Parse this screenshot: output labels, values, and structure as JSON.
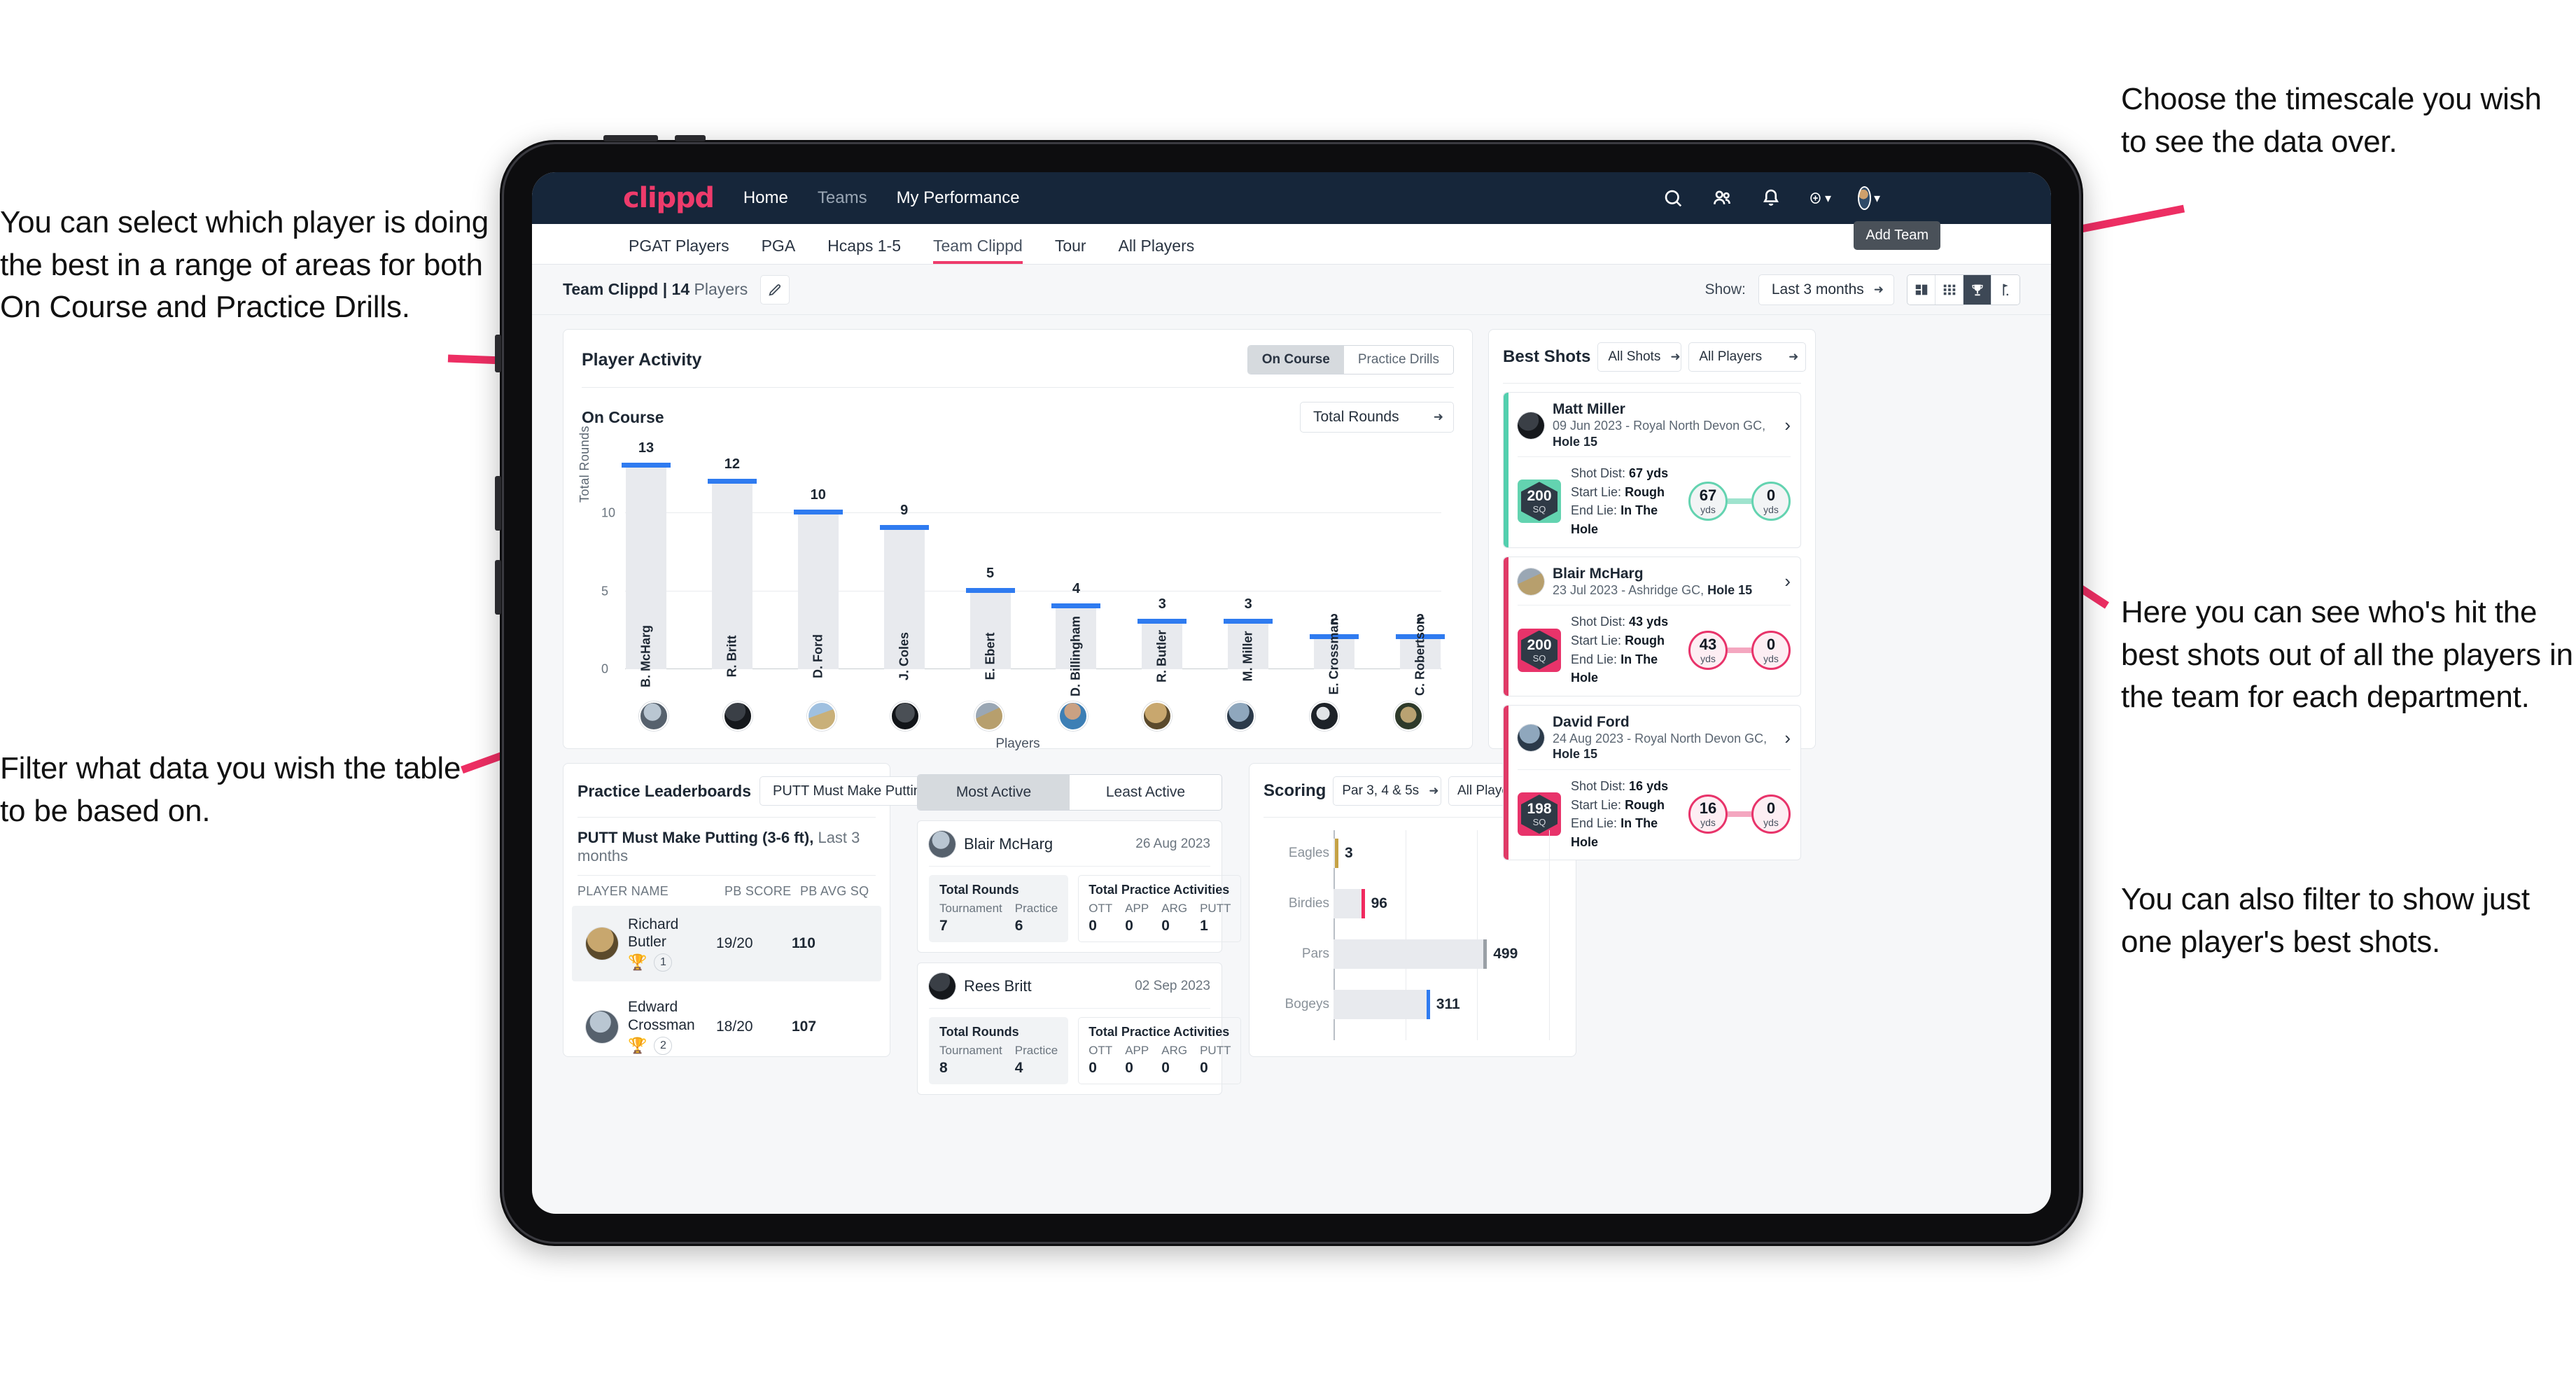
{
  "annotations": {
    "left_top": "You can select which player is doing the best in a range of areas for both On Course and Practice Drills.",
    "left_bottom": "Filter what data you wish the table to be based on.",
    "right_top": "Choose the timescale you wish to see the data over.",
    "right_mid": "Here you can see who's hit the best shots out of all the players in the team for each department.",
    "right_bottom": "You can also filter to show just one player's best shots."
  },
  "topnav": {
    "brand": "clippd",
    "links": [
      {
        "label": "Home",
        "active": true
      },
      {
        "label": "Teams",
        "active": false
      },
      {
        "label": "My Performance",
        "active": true
      }
    ],
    "icons": [
      "search-icon",
      "people-icon",
      "bell-icon",
      "plus-circle-icon",
      "avatar"
    ]
  },
  "tabs": [
    {
      "label": "PGAT Players",
      "active": false
    },
    {
      "label": "PGA",
      "active": false
    },
    {
      "label": "Hcaps 1-5",
      "active": false
    },
    {
      "label": "Team Clippd",
      "active": true
    },
    {
      "label": "Tour",
      "active": false
    },
    {
      "label": "All Players",
      "active": false
    }
  ],
  "tooltip": {
    "add_team": "Add Team"
  },
  "toolbar": {
    "team_name": "Team Clippd",
    "separator": "|",
    "player_count": "14",
    "players_word": "Players",
    "edit_icon": "pencil-icon",
    "show_label": "Show:",
    "timescale_value": "Last 3 months",
    "view_buttons": [
      "cards-view",
      "grid-view",
      "trophy-view",
      "flag-view"
    ],
    "active_view": "trophy-view"
  },
  "player_activity": {
    "title": "Player Activity",
    "segments": [
      {
        "label": "On Course",
        "active": true
      },
      {
        "label": "Practice Drills",
        "active": false
      }
    ],
    "subtitle": "On Course",
    "metric_select": "Total Rounds"
  },
  "chart_data": {
    "type": "bar",
    "title": "Player Activity - On Course",
    "xlabel": "Players",
    "ylabel": "Total Rounds",
    "categories": [
      "B. McHarg",
      "R. Britt",
      "D. Ford",
      "J. Coles",
      "E. Ebert",
      "D. Billingham",
      "R. Butler",
      "M. Miller",
      "E. Crossman",
      "C. Robertson"
    ],
    "values": [
      13,
      12,
      10,
      9,
      5,
      4,
      3,
      3,
      2,
      2
    ],
    "ylim": [
      0,
      14
    ],
    "yticks": [
      0,
      5,
      10
    ],
    "grid": true,
    "bar_color": "#e8eaee",
    "cap_color": "#2f7bf0"
  },
  "best_shots": {
    "title": "Best Shots",
    "shot_filter": "All Shots",
    "player_filter": "All Players",
    "shots": [
      {
        "player": "Matt Miller",
        "meta_date": "09 Jun 2023 - Royal North Devon GC,",
        "meta_hole": "Hole 15",
        "sq": "200",
        "sq_unit": "SQ",
        "accent": "teal",
        "shot_dist_label": "Shot Dist:",
        "shot_dist": "67 yds",
        "start_lie_label": "Start Lie:",
        "start_lie": "Rough",
        "end_lie_label": "End Lie:",
        "end_lie": "In The Hole",
        "from_value": "67",
        "from_unit": "yds",
        "to_value": "0",
        "to_unit": "yds"
      },
      {
        "player": "Blair McHarg",
        "meta_date": "23 Jul 2023 - Ashridge GC,",
        "meta_hole": "Hole 15",
        "sq": "200",
        "sq_unit": "SQ",
        "accent": "pink",
        "shot_dist_label": "Shot Dist:",
        "shot_dist": "43 yds",
        "start_lie_label": "Start Lie:",
        "start_lie": "Rough",
        "end_lie_label": "End Lie:",
        "end_lie": "In The Hole",
        "from_value": "43",
        "from_unit": "yds",
        "to_value": "0",
        "to_unit": "yds"
      },
      {
        "player": "David Ford",
        "meta_date": "24 Aug 2023 - Royal North Devon GC,",
        "meta_hole": "Hole 15",
        "sq": "198",
        "sq_unit": "SQ",
        "accent": "pink",
        "shot_dist_label": "Shot Dist:",
        "shot_dist": "16 yds",
        "start_lie_label": "Start Lie:",
        "start_lie": "Rough",
        "end_lie_label": "End Lie:",
        "end_lie": "In The Hole",
        "from_value": "16",
        "from_unit": "yds",
        "to_value": "0",
        "to_unit": "yds"
      }
    ]
  },
  "practice_leaderboards": {
    "title": "Practice Leaderboards",
    "drill_select": "PUTT Must Make Putting ...",
    "subtitle_bold": "PUTT Must Make Putting (3-6 ft),",
    "subtitle_light": "Last 3 months",
    "columns": [
      "PLAYER NAME",
      "PB SCORE",
      "PB AVG SQ"
    ],
    "rows": [
      {
        "name": "Richard Butler",
        "rank": "1",
        "trophy": "gold",
        "pb_score": "19/20",
        "pb_avg_sq": "110"
      },
      {
        "name": "Edward Crossman",
        "rank": "2",
        "trophy": "silver",
        "pb_score": "18/20",
        "pb_avg_sq": "107"
      }
    ]
  },
  "activity": {
    "tabs": [
      {
        "label": "Most Active",
        "active": true
      },
      {
        "label": "Least Active",
        "active": false
      }
    ],
    "cards": [
      {
        "player": "Blair McHarg",
        "date": "26 Aug 2023",
        "rounds_title": "Total Rounds",
        "rounds": [
          {
            "key": "Tournament",
            "value": "7"
          },
          {
            "key": "Practice",
            "value": "6"
          }
        ],
        "practice_title": "Total Practice Activities",
        "practice": [
          {
            "key": "OTT",
            "value": "0"
          },
          {
            "key": "APP",
            "value": "0"
          },
          {
            "key": "ARG",
            "value": "0"
          },
          {
            "key": "PUTT",
            "value": "1"
          }
        ]
      },
      {
        "player": "Rees Britt",
        "date": "02 Sep 2023",
        "rounds_title": "Total Rounds",
        "rounds": [
          {
            "key": "Tournament",
            "value": "8"
          },
          {
            "key": "Practice",
            "value": "4"
          }
        ],
        "practice_title": "Total Practice Activities",
        "practice": [
          {
            "key": "OTT",
            "value": "0"
          },
          {
            "key": "APP",
            "value": "0"
          },
          {
            "key": "ARG",
            "value": "0"
          },
          {
            "key": "PUTT",
            "value": "0"
          }
        ]
      }
    ]
  },
  "scoring": {
    "title": "Scoring",
    "par_filter": "Par 3, 4 & 5s",
    "player_filter": "All Players"
  },
  "scoring_chart": {
    "type": "bar",
    "orientation": "horizontal",
    "title": "Scoring",
    "categories": [
      "Eagles",
      "Birdies",
      "Pars",
      "Bogeys"
    ],
    "values": [
      3,
      96,
      499,
      311
    ],
    "tip_colors": [
      "#c5a246",
      "#f02a5f",
      "#9aa0a6",
      "#2f7bf0"
    ],
    "xlim": [
      0,
      600
    ],
    "grid": true
  },
  "colors": {
    "brand_pink": "#ee3b6b",
    "nav_dark": "#16263a",
    "teal": "#63d3b0",
    "blue": "#2f7bf0"
  }
}
